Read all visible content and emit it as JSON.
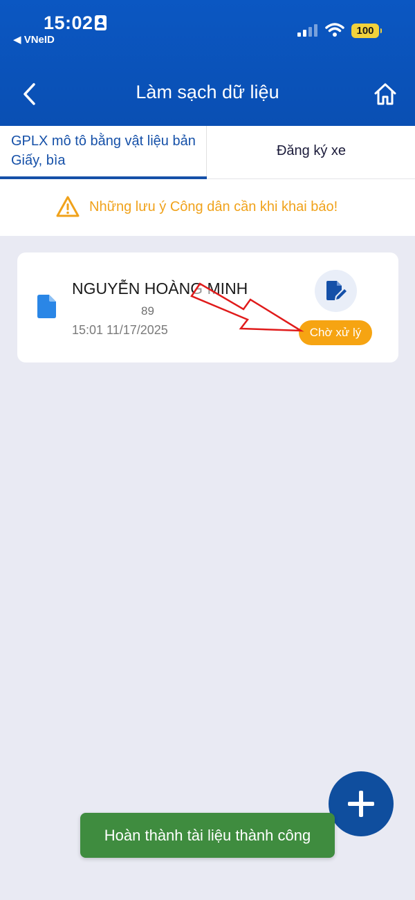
{
  "status_bar": {
    "time": "15:02",
    "back_app": "◀ VNeID",
    "battery": "100"
  },
  "header": {
    "title": "Làm sạch dữ liệu",
    "back_icon": "chevron-left-icon",
    "home_icon": "home-icon"
  },
  "tabs": [
    {
      "label": "GPLX mô tô bằng vật liệu bản Giấy, bìa",
      "active": true
    },
    {
      "label": "Đăng ký xe",
      "active": false
    }
  ],
  "notice": {
    "icon": "warning-icon",
    "text": "Những lưu ý Công dân cần khi khai báo!"
  },
  "record": {
    "name": "NGUYỄN HOÀNG MINH",
    "number": "89",
    "datetime": "15:01 11/17/2025",
    "status": "Chờ xử lý",
    "doc_icon": "document-icon",
    "edit_icon": "edit-document-icon"
  },
  "fab_icon": "plus-icon",
  "toast": {
    "message": "Hoàn thành tài liệu thành công"
  },
  "colors": {
    "primary": "#0b57c2",
    "warning": "#f0a21b",
    "badge": "#f6a412",
    "success": "#3f8c3f",
    "annotation_arrow": "#e01b1b"
  }
}
